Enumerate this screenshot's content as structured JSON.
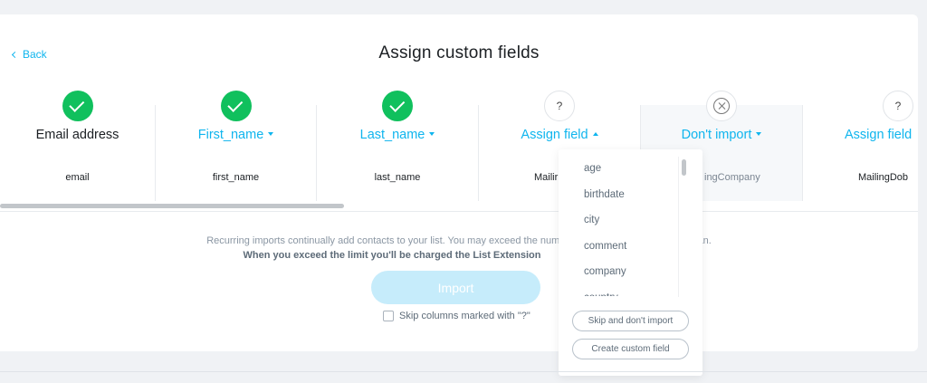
{
  "header": {
    "back_label": "Back",
    "title": "Assign custom fields"
  },
  "columns": [
    {
      "status": "assigned",
      "status_icon": "checkmark-icon",
      "field_label": "Email address",
      "is_dropdown": false,
      "source": "email"
    },
    {
      "status": "assigned",
      "status_icon": "checkmark-icon",
      "field_label": "First_name",
      "is_dropdown": true,
      "source": "first_name"
    },
    {
      "status": "assigned",
      "status_icon": "checkmark-icon",
      "field_label": "Last_name",
      "is_dropdown": true,
      "source": "last_name"
    },
    {
      "status": "unassigned",
      "status_icon": "question-icon",
      "status_text": "?",
      "field_label": "Assign field",
      "is_dropdown": true,
      "open": true,
      "source": "Mailir"
    },
    {
      "status": "skipped",
      "status_icon": "cancel-circle-icon",
      "field_label": "Don't import",
      "is_dropdown": true,
      "source": "ingCompany"
    },
    {
      "status": "unassigned",
      "status_icon": "question-icon",
      "status_text": "?",
      "field_label": "Assign field",
      "is_dropdown": true,
      "source": "MailingDob"
    }
  ],
  "notice": {
    "line1": "Recurring imports continually add contacts to your list. You may exceed the numbe",
    "line1_tail": "an.",
    "line2": "When you exceed the limit you'll be charged the List Extension"
  },
  "import_button": {
    "label": "Import"
  },
  "skip_checkbox": {
    "label": "Skip columns marked with \"?\"",
    "checked": false
  },
  "field_dropdown": {
    "options": [
      "age",
      "birthdate",
      "city",
      "comment",
      "company",
      "country"
    ],
    "skip_button": "Skip and don't import",
    "create_button": "Create custom field"
  },
  "colors": {
    "accent": "#0fb5ee",
    "success": "#10c05d",
    "import_disabled": "#c6ecfb"
  }
}
